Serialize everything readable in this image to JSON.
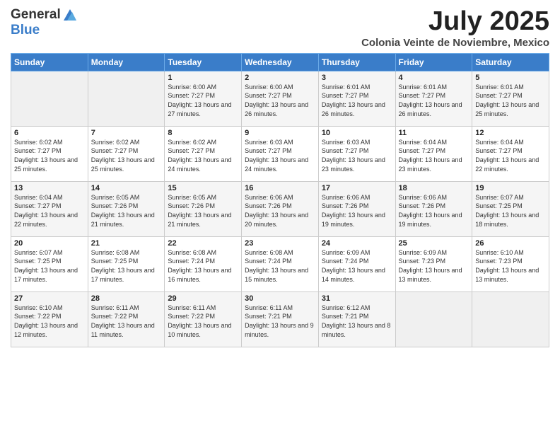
{
  "header": {
    "logo_general": "General",
    "logo_blue": "Blue",
    "month_title": "July 2025",
    "subtitle": "Colonia Veinte de Noviembre, Mexico"
  },
  "days_of_week": [
    "Sunday",
    "Monday",
    "Tuesday",
    "Wednesday",
    "Thursday",
    "Friday",
    "Saturday"
  ],
  "weeks": [
    [
      {
        "day": "",
        "sunrise": "",
        "sunset": "",
        "daylight": ""
      },
      {
        "day": "",
        "sunrise": "",
        "sunset": "",
        "daylight": ""
      },
      {
        "day": "1",
        "sunrise": "Sunrise: 6:00 AM",
        "sunset": "Sunset: 7:27 PM",
        "daylight": "Daylight: 13 hours and 27 minutes."
      },
      {
        "day": "2",
        "sunrise": "Sunrise: 6:00 AM",
        "sunset": "Sunset: 7:27 PM",
        "daylight": "Daylight: 13 hours and 26 minutes."
      },
      {
        "day": "3",
        "sunrise": "Sunrise: 6:01 AM",
        "sunset": "Sunset: 7:27 PM",
        "daylight": "Daylight: 13 hours and 26 minutes."
      },
      {
        "day": "4",
        "sunrise": "Sunrise: 6:01 AM",
        "sunset": "Sunset: 7:27 PM",
        "daylight": "Daylight: 13 hours and 26 minutes."
      },
      {
        "day": "5",
        "sunrise": "Sunrise: 6:01 AM",
        "sunset": "Sunset: 7:27 PM",
        "daylight": "Daylight: 13 hours and 25 minutes."
      }
    ],
    [
      {
        "day": "6",
        "sunrise": "Sunrise: 6:02 AM",
        "sunset": "Sunset: 7:27 PM",
        "daylight": "Daylight: 13 hours and 25 minutes."
      },
      {
        "day": "7",
        "sunrise": "Sunrise: 6:02 AM",
        "sunset": "Sunset: 7:27 PM",
        "daylight": "Daylight: 13 hours and 25 minutes."
      },
      {
        "day": "8",
        "sunrise": "Sunrise: 6:02 AM",
        "sunset": "Sunset: 7:27 PM",
        "daylight": "Daylight: 13 hours and 24 minutes."
      },
      {
        "day": "9",
        "sunrise": "Sunrise: 6:03 AM",
        "sunset": "Sunset: 7:27 PM",
        "daylight": "Daylight: 13 hours and 24 minutes."
      },
      {
        "day": "10",
        "sunrise": "Sunrise: 6:03 AM",
        "sunset": "Sunset: 7:27 PM",
        "daylight": "Daylight: 13 hours and 23 minutes."
      },
      {
        "day": "11",
        "sunrise": "Sunrise: 6:04 AM",
        "sunset": "Sunset: 7:27 PM",
        "daylight": "Daylight: 13 hours and 23 minutes."
      },
      {
        "day": "12",
        "sunrise": "Sunrise: 6:04 AM",
        "sunset": "Sunset: 7:27 PM",
        "daylight": "Daylight: 13 hours and 22 minutes."
      }
    ],
    [
      {
        "day": "13",
        "sunrise": "Sunrise: 6:04 AM",
        "sunset": "Sunset: 7:27 PM",
        "daylight": "Daylight: 13 hours and 22 minutes."
      },
      {
        "day": "14",
        "sunrise": "Sunrise: 6:05 AM",
        "sunset": "Sunset: 7:26 PM",
        "daylight": "Daylight: 13 hours and 21 minutes."
      },
      {
        "day": "15",
        "sunrise": "Sunrise: 6:05 AM",
        "sunset": "Sunset: 7:26 PM",
        "daylight": "Daylight: 13 hours and 21 minutes."
      },
      {
        "day": "16",
        "sunrise": "Sunrise: 6:06 AM",
        "sunset": "Sunset: 7:26 PM",
        "daylight": "Daylight: 13 hours and 20 minutes."
      },
      {
        "day": "17",
        "sunrise": "Sunrise: 6:06 AM",
        "sunset": "Sunset: 7:26 PM",
        "daylight": "Daylight: 13 hours and 19 minutes."
      },
      {
        "day": "18",
        "sunrise": "Sunrise: 6:06 AM",
        "sunset": "Sunset: 7:26 PM",
        "daylight": "Daylight: 13 hours and 19 minutes."
      },
      {
        "day": "19",
        "sunrise": "Sunrise: 6:07 AM",
        "sunset": "Sunset: 7:25 PM",
        "daylight": "Daylight: 13 hours and 18 minutes."
      }
    ],
    [
      {
        "day": "20",
        "sunrise": "Sunrise: 6:07 AM",
        "sunset": "Sunset: 7:25 PM",
        "daylight": "Daylight: 13 hours and 17 minutes."
      },
      {
        "day": "21",
        "sunrise": "Sunrise: 6:08 AM",
        "sunset": "Sunset: 7:25 PM",
        "daylight": "Daylight: 13 hours and 17 minutes."
      },
      {
        "day": "22",
        "sunrise": "Sunrise: 6:08 AM",
        "sunset": "Sunset: 7:24 PM",
        "daylight": "Daylight: 13 hours and 16 minutes."
      },
      {
        "day": "23",
        "sunrise": "Sunrise: 6:08 AM",
        "sunset": "Sunset: 7:24 PM",
        "daylight": "Daylight: 13 hours and 15 minutes."
      },
      {
        "day": "24",
        "sunrise": "Sunrise: 6:09 AM",
        "sunset": "Sunset: 7:24 PM",
        "daylight": "Daylight: 13 hours and 14 minutes."
      },
      {
        "day": "25",
        "sunrise": "Sunrise: 6:09 AM",
        "sunset": "Sunset: 7:23 PM",
        "daylight": "Daylight: 13 hours and 13 minutes."
      },
      {
        "day": "26",
        "sunrise": "Sunrise: 6:10 AM",
        "sunset": "Sunset: 7:23 PM",
        "daylight": "Daylight: 13 hours and 13 minutes."
      }
    ],
    [
      {
        "day": "27",
        "sunrise": "Sunrise: 6:10 AM",
        "sunset": "Sunset: 7:22 PM",
        "daylight": "Daylight: 13 hours and 12 minutes."
      },
      {
        "day": "28",
        "sunrise": "Sunrise: 6:11 AM",
        "sunset": "Sunset: 7:22 PM",
        "daylight": "Daylight: 13 hours and 11 minutes."
      },
      {
        "day": "29",
        "sunrise": "Sunrise: 6:11 AM",
        "sunset": "Sunset: 7:22 PM",
        "daylight": "Daylight: 13 hours and 10 minutes."
      },
      {
        "day": "30",
        "sunrise": "Sunrise: 6:11 AM",
        "sunset": "Sunset: 7:21 PM",
        "daylight": "Daylight: 13 hours and 9 minutes."
      },
      {
        "day": "31",
        "sunrise": "Sunrise: 6:12 AM",
        "sunset": "Sunset: 7:21 PM",
        "daylight": "Daylight: 13 hours and 8 minutes."
      },
      {
        "day": "",
        "sunrise": "",
        "sunset": "",
        "daylight": ""
      },
      {
        "day": "",
        "sunrise": "",
        "sunset": "",
        "daylight": ""
      }
    ]
  ]
}
